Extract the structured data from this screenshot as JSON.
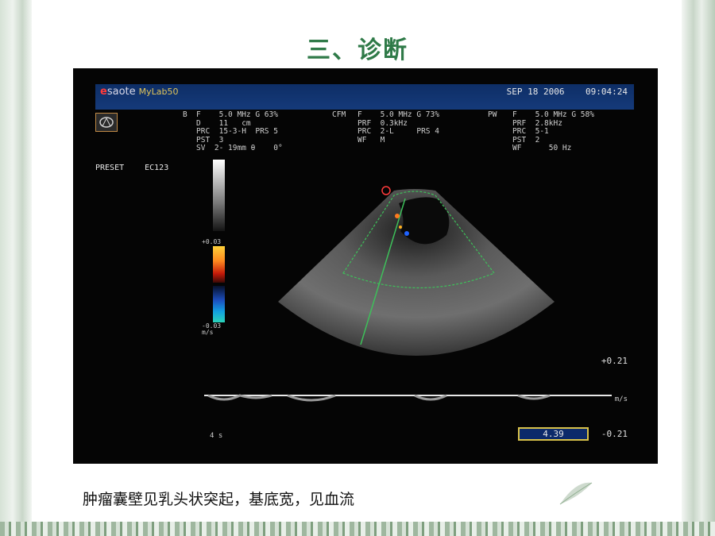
{
  "slide": {
    "title": "三、诊断",
    "caption": "肿瘤囊壁见乳头状突起，基底宽，见血流"
  },
  "ultrasound": {
    "brand": "saote",
    "brand_prefix": "e",
    "model": "MyLab50",
    "date": "SEP 18 2006",
    "time": "09:04:24",
    "b_mode_label": "B",
    "b_mode_lines": "F    5.0 MHz G 63%\nD    11   cm\nPRC  15-3-H  PRS 5\nPST  3\nSV  2- 19mm θ    0°",
    "cfm_label": "CFM",
    "cfm_lines": "F    5.0 MHz G 73%\nPRF  0.3kHz\nPRC  2-L     PRS 4\nWF   M",
    "pw_label": "PW",
    "pw_lines": "F    5.0 MHz G 58%\nPRF  2.8kHz\nPRC  5-1\nPST  2\nWF      50 Hz",
    "preset_label": "PRESET",
    "preset_value": "EC123",
    "color_scale_top": "+0.03",
    "color_scale_bottom": "-0.03",
    "color_scale_unit": "m/s",
    "velocity_top": "+0.21",
    "velocity_bottom": "-0.21",
    "velocity_unit": "m/s",
    "time_scale": "4 s",
    "measurement": "4.39"
  },
  "colors": {
    "title": "#2f7a48",
    "screen_bg": "#050505",
    "header_bar": "#153a7a",
    "roi_box": "#3ec05a",
    "measurement_border": "#d8c24a"
  }
}
